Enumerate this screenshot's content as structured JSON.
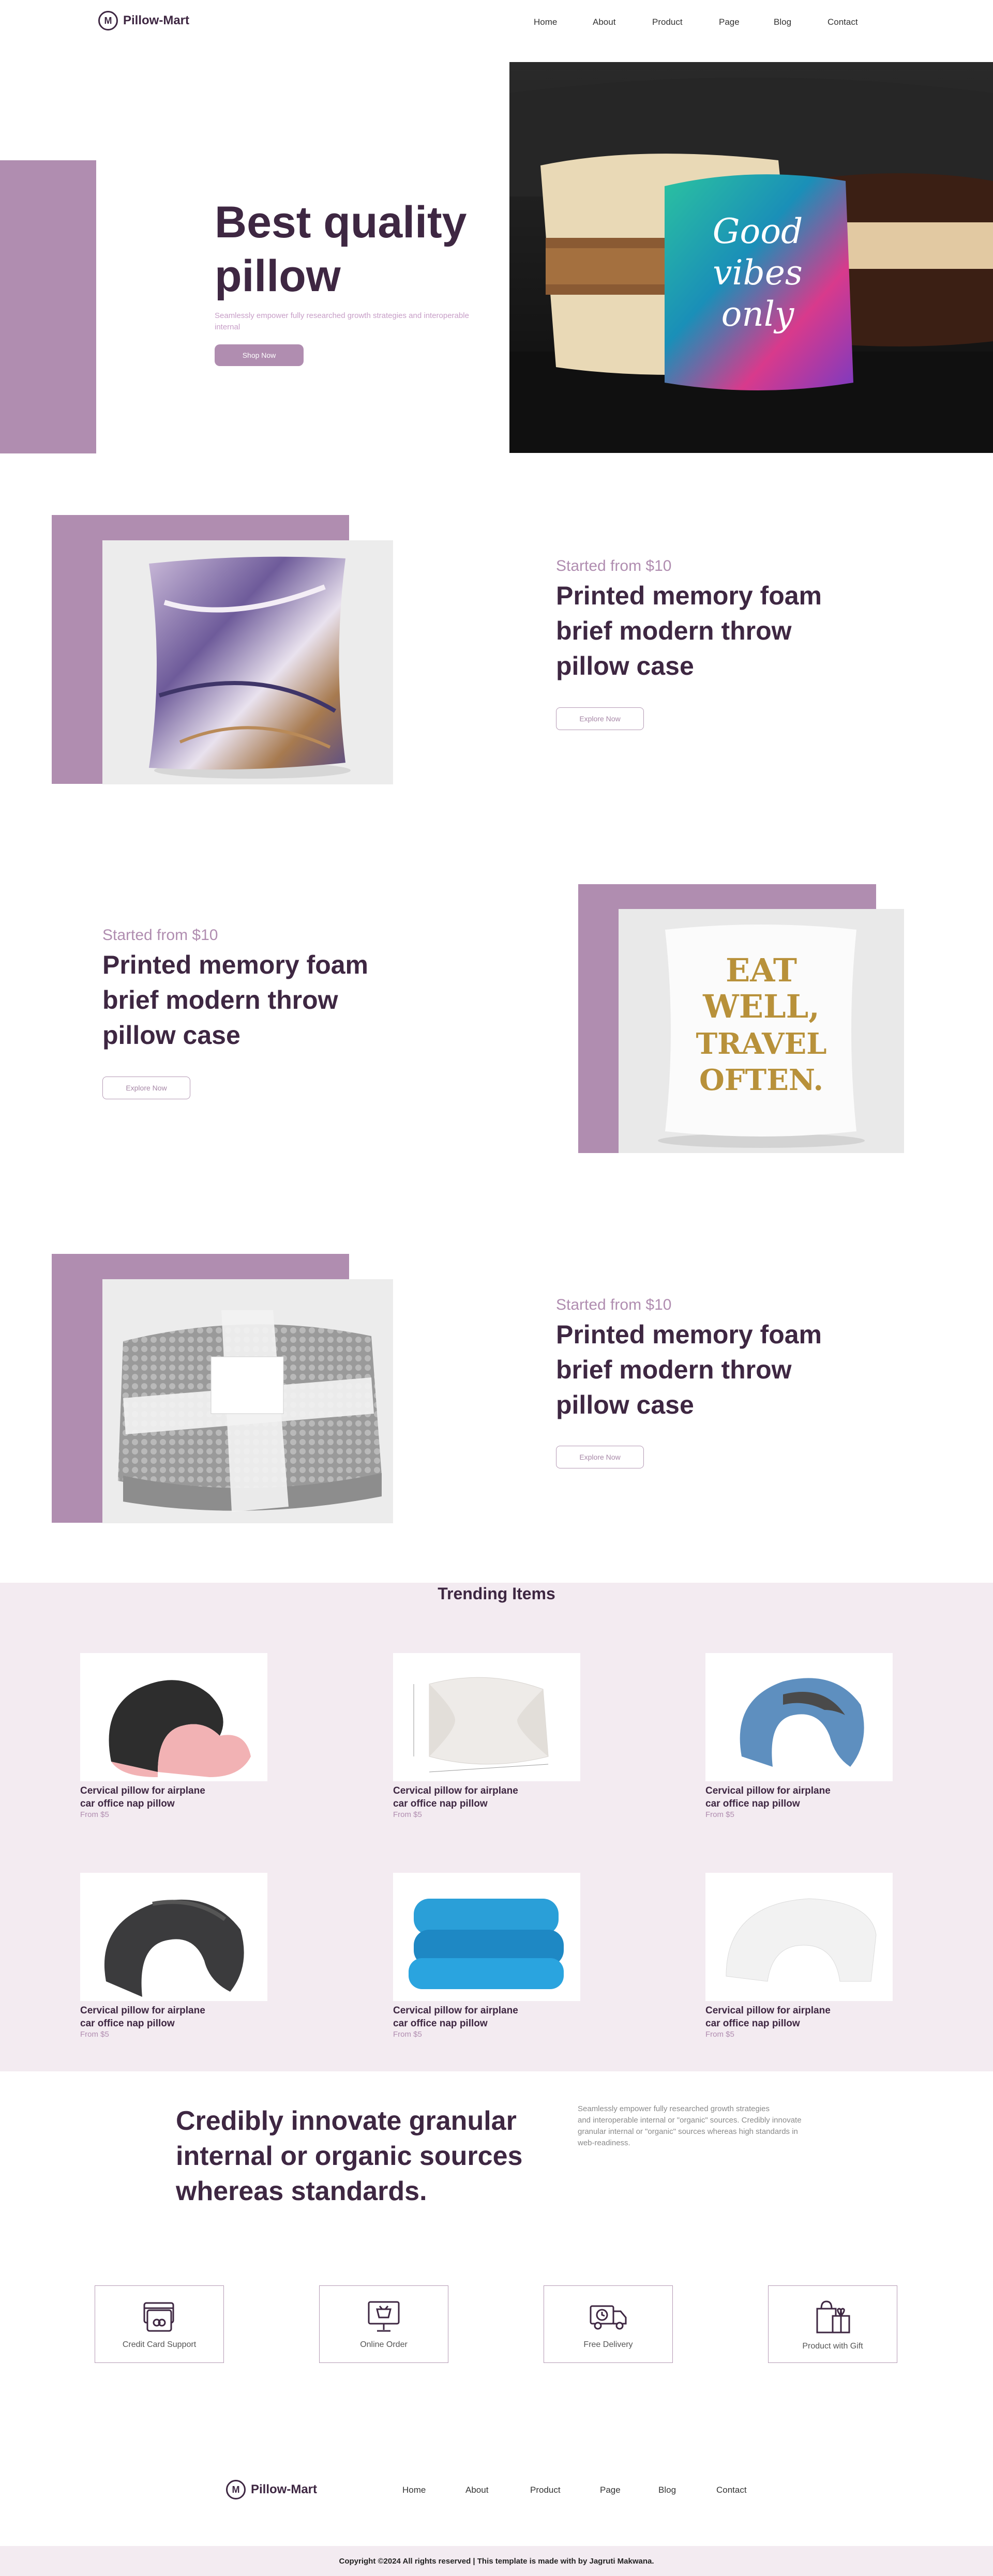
{
  "brand": {
    "name": "Pillow-Mart",
    "logo_letter": "M"
  },
  "nav": [
    "Home",
    "About",
    "Product",
    "Page",
    "Blog",
    "Contact"
  ],
  "hero": {
    "title_line1": "Best quality",
    "title_line2": "pillow",
    "subtitle": "Seamlessly empower fully researched growth strategies and interoperable internal",
    "button": "Shop Now"
  },
  "features_rows": [
    {
      "started": "Started from $10",
      "title_l1": "Printed memory foam",
      "title_l2": "brief modern throw",
      "title_l3": "pillow case",
      "button": "Explore Now"
    },
    {
      "started": "Started from $10",
      "title_l1": "Printed memory foam",
      "title_l2": "brief modern throw",
      "title_l3": "pillow case",
      "button": "Explore Now"
    },
    {
      "started": "Started from $10",
      "title_l1": "Printed memory foam",
      "title_l2": "brief modern throw",
      "title_l3": "pillow case",
      "button": "Explore Now"
    }
  ],
  "pillow_text": {
    "l1": "EAT",
    "l2": "WELL,",
    "l3": "TRAVEL",
    "l4": "OFTEN.",
    "hero_l1": "Good",
    "hero_l2": "vibes",
    "hero_l3": "only"
  },
  "trending": {
    "title": "Trending Items",
    "items": [
      {
        "name_l1": "Cervical pillow for airplane",
        "name_l2": "car office nap pillow",
        "price": "From $5"
      },
      {
        "name_l1": "Cervical pillow for airplane",
        "name_l2": "car office nap pillow",
        "price": "From $5"
      },
      {
        "name_l1": "Cervical pillow for airplane",
        "name_l2": "car office nap pillow",
        "price": "From $5"
      },
      {
        "name_l1": "Cervical pillow for airplane",
        "name_l2": "car office nap pillow",
        "price": "From $5"
      },
      {
        "name_l1": "Cervical pillow for airplane",
        "name_l2": "car office nap pillow",
        "price": "From $5"
      },
      {
        "name_l1": "Cervical pillow for airplane",
        "name_l2": "car office nap pillow",
        "price": "From $5"
      }
    ]
  },
  "about": {
    "heading_l1": "Credibly innovate granular",
    "heading_l2": "internal or organic sources",
    "heading_l3": "whereas standards.",
    "text_l1": "Seamlessly empower fully researched growth strategies",
    "text_l2": "and interoperable internal or \"organic\" sources. Credibly innovate",
    "text_l3": "granular internal or \"organic\" sources whereas high standards in",
    "text_l4": "web-readiness."
  },
  "services": [
    {
      "label": "Credit Card Support",
      "icon": "credit-card-icon"
    },
    {
      "label": "Online Order",
      "icon": "online-order-icon"
    },
    {
      "label": "Free Delivery",
      "icon": "delivery-truck-icon"
    },
    {
      "label": "Product with Gift",
      "icon": "gift-icon"
    }
  ],
  "footer": {
    "links": [
      "Home",
      "About",
      "Product",
      "Page",
      "Blog",
      "Contact"
    ],
    "copyright": "Copyright ©2024 All rights reserved | This template is made with by Jagruti Makwana."
  },
  "colors": {
    "accent": "#b08db0",
    "dark": "#3e2742",
    "section_bg": "#f3ebf1"
  }
}
